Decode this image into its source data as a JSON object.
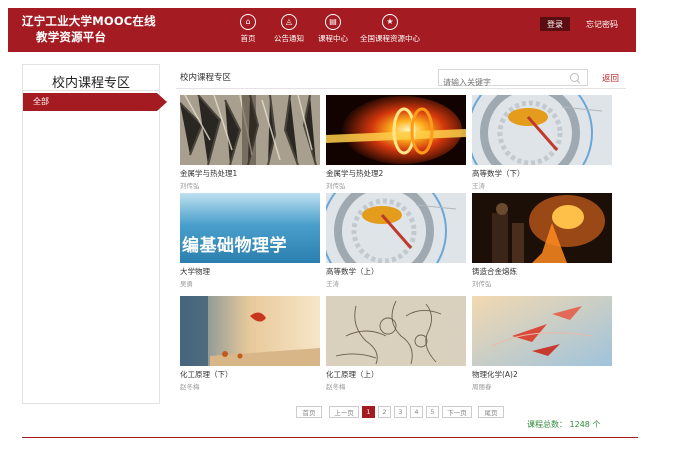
{
  "header": {
    "title_line1": "辽宁工业大学MOOC在线",
    "title_line2": "教学资源平台",
    "nav": [
      {
        "label": "首页",
        "icon": "home-icon",
        "glyph": "⌂"
      },
      {
        "label": "公告通知",
        "icon": "notice-icon",
        "glyph": "◬"
      },
      {
        "label": "课程中心",
        "icon": "course-icon",
        "glyph": "▤"
      },
      {
        "label": "全国课程资源中心",
        "icon": "star-icon",
        "glyph": "★"
      }
    ],
    "login_label": "登录",
    "forgot_label": "忘记密码"
  },
  "sidebar": {
    "title": "校内课程专区",
    "items": [
      {
        "label": "全部"
      }
    ]
  },
  "main": {
    "title": "校内课程专区",
    "search_placeholder": "请输入关键字",
    "back_label": "返回"
  },
  "courses": [
    {
      "title": "金属学与热处理1",
      "teacher": "刘传弘"
    },
    {
      "title": "金属学与热处理2",
      "teacher": "刘传弘"
    },
    {
      "title": "高等数学（下）",
      "teacher": "王涛"
    },
    {
      "title": "大学物理",
      "teacher": "吴勇",
      "thumb_text": "编基础物理学"
    },
    {
      "title": "高等数学（上）",
      "teacher": "王涛"
    },
    {
      "title": "铸造合金熔炼",
      "teacher": "刘传弘"
    },
    {
      "title": "化工原理（下）",
      "teacher": "赵冬梅"
    },
    {
      "title": "化工原理（上）",
      "teacher": "赵冬梅"
    },
    {
      "title": "物理化学(A)2",
      "teacher": "周丽春"
    }
  ],
  "pagination": {
    "first": "首页",
    "prev": "上一页",
    "pages": [
      "1",
      "2",
      "3",
      "4",
      "5"
    ],
    "current": "1",
    "next": "下一页",
    "last": "尾页"
  },
  "total_label": "课程总数： 1248 个",
  "colors": {
    "brand": "#a41c22",
    "accent_green": "#2f8b3a"
  }
}
